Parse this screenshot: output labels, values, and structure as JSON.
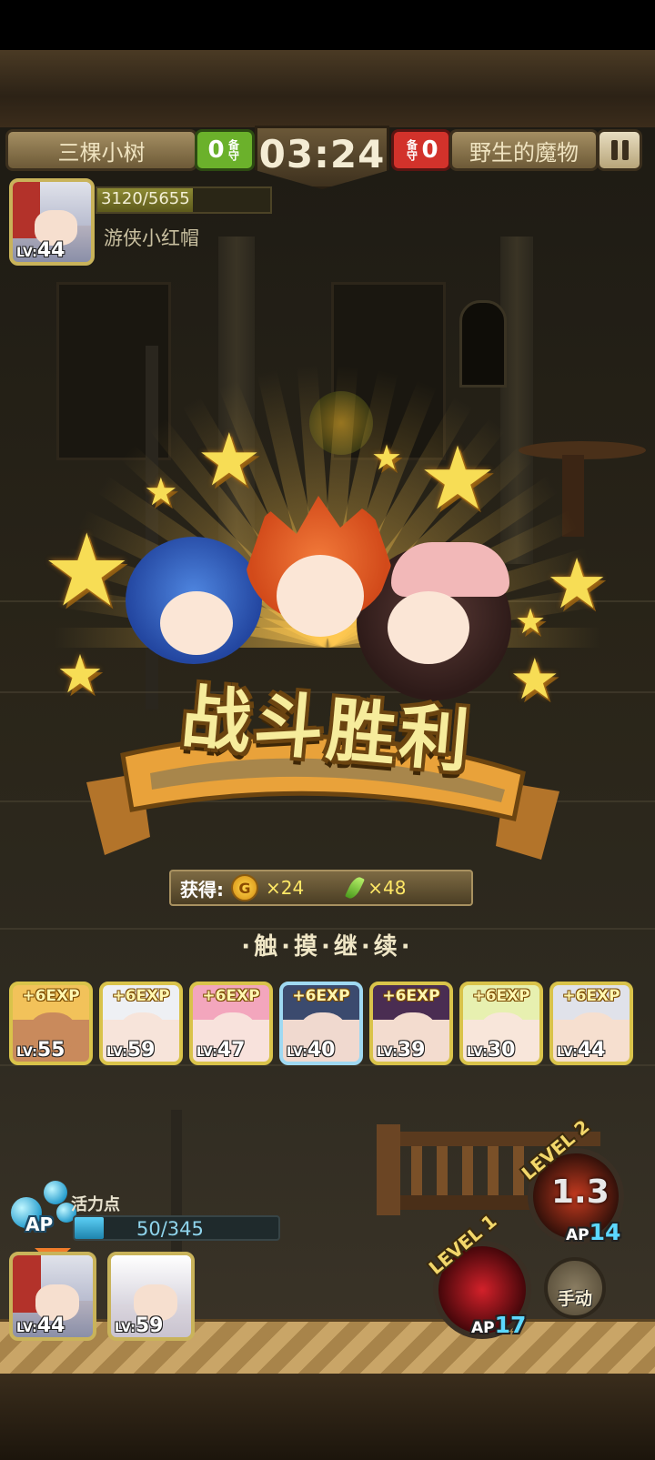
{
  "top_bar": {
    "left_team": "三棵小树",
    "left_score": "0",
    "left_defense": "备守",
    "timer": "03:24",
    "right_defense": "备守",
    "right_score": "0",
    "right_team": "野生的魔物"
  },
  "hero_status": {
    "hp_text": "3120/5655",
    "hp_fraction": 0.552,
    "name": "游侠小红帽",
    "level_prefix": "LV:",
    "level": "44"
  },
  "victory": {
    "title": "战斗胜利",
    "reward_label": "获得:",
    "coin_symbol": "G",
    "gold_amount": "×24",
    "item_amount": "×48",
    "continue_text": "·触·摸·继·续·"
  },
  "exp_cards": [
    {
      "exp": "+6EXP",
      "level": "55",
      "hair": "#f2c25a",
      "skin": "#c98a5c",
      "border": "gold"
    },
    {
      "exp": "+6EXP",
      "level": "59",
      "hair": "#eef0f4",
      "skin": "#f7e4da",
      "border": "gold"
    },
    {
      "exp": "+6EXP",
      "level": "47",
      "hair": "#f3a6bd",
      "skin": "#f8e2dc",
      "border": "gold"
    },
    {
      "exp": "+6EXP",
      "level": "40",
      "hair": "#3b4a6e",
      "skin": "#f0d9cf",
      "border": "blue"
    },
    {
      "exp": "+6EXP",
      "level": "39",
      "hair": "#4a2d52",
      "skin": "#f3dccf",
      "border": "gold"
    },
    {
      "exp": "+6EXP",
      "level": "30",
      "hair": "#e7f0b0",
      "skin": "#f8e6da",
      "border": "gold"
    },
    {
      "exp": "+6EXP",
      "level": "44",
      "hair": "#e0e2ea",
      "skin": "#f6dfcf",
      "border": "gold"
    }
  ],
  "ap": {
    "icon_label": "AP",
    "title": "活力点",
    "text": "50/345",
    "fraction": 0.145
  },
  "team_portraits": [
    {
      "level": "44"
    },
    {
      "level": "59"
    }
  ],
  "skills": {
    "skill_2": {
      "level_label": "LEVEL 2",
      "cooldown": "1.3",
      "ap_prefix": "AP",
      "ap_cost": "14"
    },
    "skill_1": {
      "level_label": "LEVEL 1",
      "ap_prefix": "AP",
      "ap_cost": "17"
    },
    "manual_label": "手动"
  },
  "colors": {
    "gold": "#f6ec9c",
    "ribbon": "#e9a23a",
    "green_team": "#6bb12b",
    "red_team": "#d2322b",
    "ap_blue": "#5ccff5"
  }
}
